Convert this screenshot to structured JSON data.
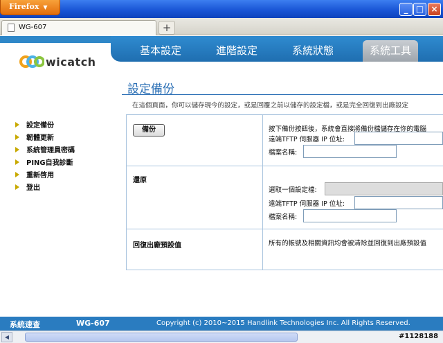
{
  "browser": {
    "menu_button": "Firefox",
    "tab_title": "WG-607",
    "new_tab": "+",
    "window_controls": {
      "minimize": "_",
      "restore": "□",
      "close": "×"
    }
  },
  "header": {
    "logo_text": "wicatch",
    "nav": [
      "基本設定",
      "進階設定",
      "系統狀態",
      "系統工具"
    ],
    "active_nav": "系統工具"
  },
  "sidebar": {
    "items": [
      {
        "label": "設定備份"
      },
      {
        "label": "韌體更新"
      },
      {
        "label": "系統管理員密碼"
      },
      {
        "label": "PING自我診斷"
      },
      {
        "label": "重新啓用"
      },
      {
        "label": "登出"
      }
    ]
  },
  "main": {
    "title": "設定備份",
    "intro": "在這個頁面，你可以儲存現今的設定，或是回覆之前以儲存的設定檔，或是完全回復到出廠設定",
    "backup": {
      "button": "備份",
      "description": "按下備份按鈕後，系統會直接將備份檔儲存在你的電腦",
      "tftp_label": "遠端TFTP 伺服器 IP 位址:",
      "filename_label": "檔案名稱:",
      "tftp_value": "",
      "filename_value": ""
    },
    "restore": {
      "label": "還原",
      "select_file_label": "選取一個設定檔:",
      "tftp_label": "遠端TFTP 伺服器 IP 位址:",
      "filename_label": "檔案名稱:",
      "tftp_value": "",
      "filename_value": ""
    },
    "factory": {
      "label": "回復出廠預設值",
      "description": "所有的帳號及相關資訊均會被清除並回復到出廠預設值"
    }
  },
  "footer": {
    "label": "系統速查",
    "model": "WG-607",
    "copyright": "Copyright (c) 2010~2015 Handlink Technologies Inc. All Rights Reserved."
  },
  "watermark": "#1128188",
  "colors": {
    "brand_blue": "#2e87c8",
    "title_blue": "#2b6fb5",
    "firefox_orange": "#e36d0b"
  }
}
